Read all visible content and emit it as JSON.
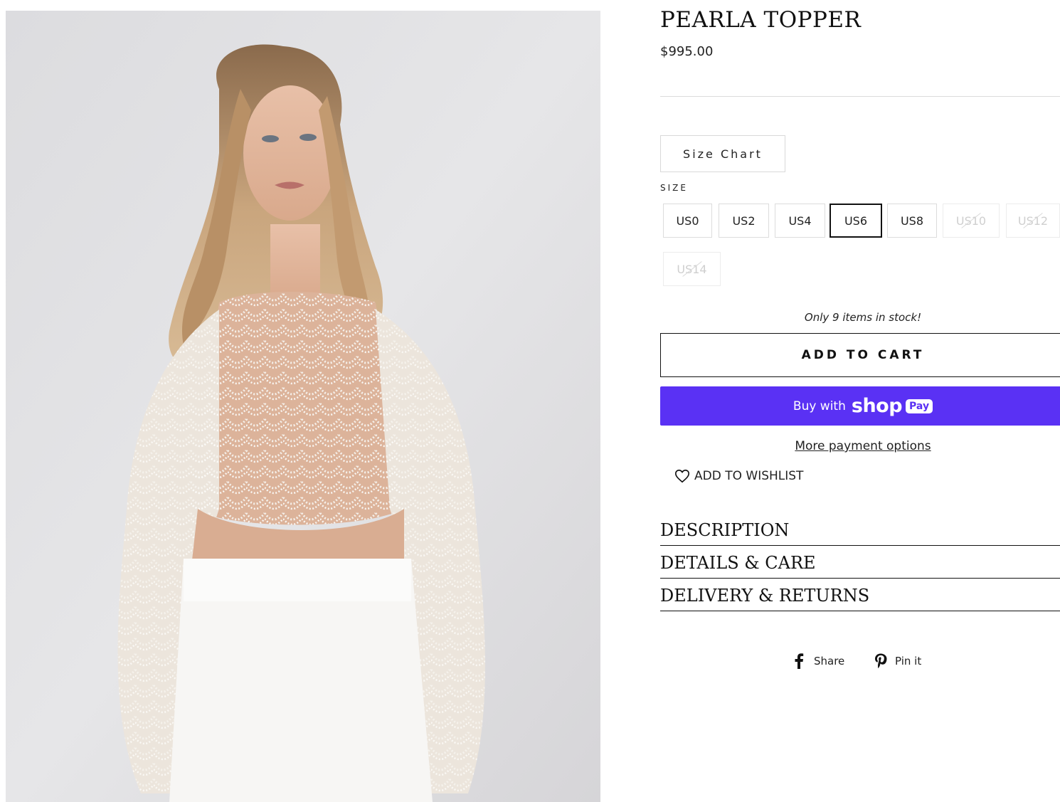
{
  "product": {
    "title": "PEARLA TOPPER",
    "price": "$995.00",
    "image_alt": "Model wearing pearl-beaded sheer crop top with white trousers"
  },
  "size_chart_label": "Size Chart",
  "size_selector": {
    "label": "SIZE",
    "selected": "US6",
    "options": [
      {
        "label": "US0",
        "available": true
      },
      {
        "label": "US2",
        "available": true
      },
      {
        "label": "US4",
        "available": true
      },
      {
        "label": "US6",
        "available": true
      },
      {
        "label": "US8",
        "available": true
      },
      {
        "label": "US10",
        "available": false
      },
      {
        "label": "US12",
        "available": false
      },
      {
        "label": "US14",
        "available": false
      }
    ]
  },
  "stock_message": "Only 9 items in stock!",
  "add_to_cart_label": "ADD TO CART",
  "shop_pay": {
    "buy_with": "Buy with",
    "shop": "shop",
    "pay": "Pay",
    "color": "#5a31f4"
  },
  "more_payment_label": "More payment options",
  "wishlist_label": "ADD TO WISHLIST",
  "accordion": [
    {
      "label": "DESCRIPTION"
    },
    {
      "label": "DETAILS & CARE"
    },
    {
      "label": "DELIVERY & RETURNS"
    }
  ],
  "social": {
    "share_label": "Share",
    "pin_label": "Pin it",
    "share_icon": "facebook-icon",
    "pin_icon": "pinterest-icon"
  }
}
